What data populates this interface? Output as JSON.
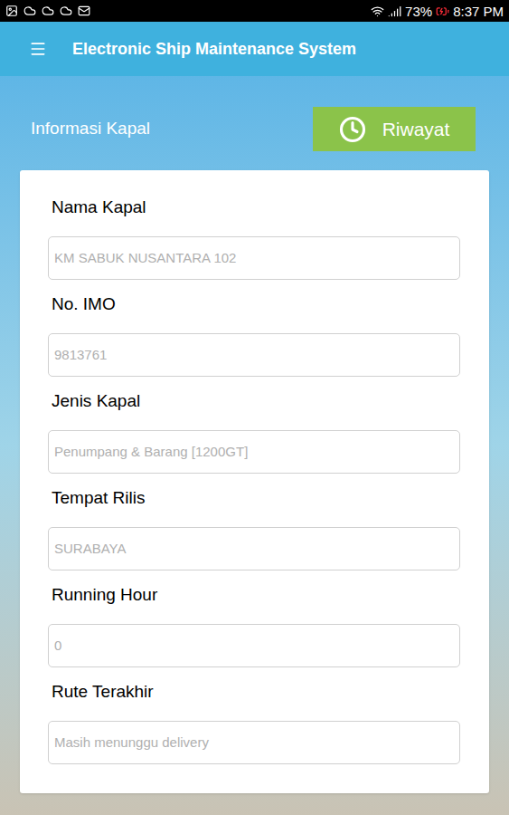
{
  "status_bar": {
    "battery": "73%",
    "time": "8:37 PM"
  },
  "app_bar": {
    "title": "Electronic Ship Maintenance System"
  },
  "section": {
    "title": "Informasi Kapal",
    "history_button": "Riwayat"
  },
  "fields": [
    {
      "label": "Nama Kapal",
      "value": "KM SABUK NUSANTARA 102"
    },
    {
      "label": "No. IMO",
      "value": "9813761"
    },
    {
      "label": "Jenis Kapal",
      "value": "Penumpang & Barang [1200GT]"
    },
    {
      "label": "Tempat Rilis",
      "value": "SURABAYA"
    },
    {
      "label": "Running Hour",
      "value": "0"
    },
    {
      "label": "Rute Terakhir",
      "value": "Masih menunggu delivery"
    }
  ]
}
